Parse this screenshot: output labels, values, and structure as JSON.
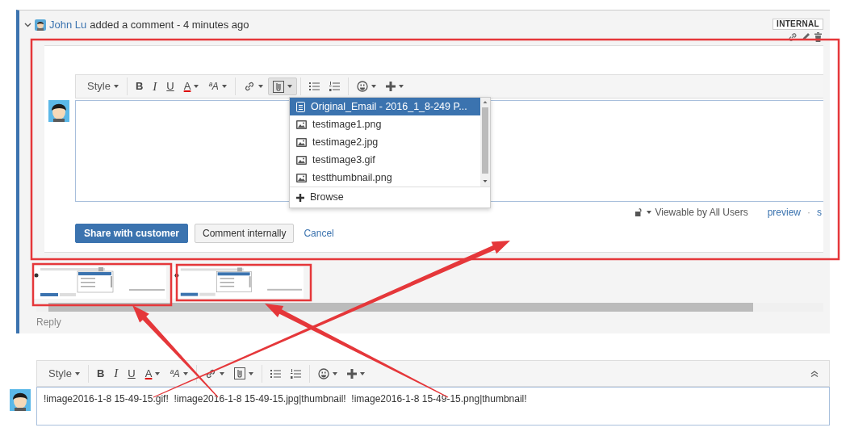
{
  "comment": {
    "author": "John Lu",
    "action": "added a comment - 4 minutes ago",
    "badge": "INTERNAL"
  },
  "editor": {
    "toolbar_groups": [
      [
        {
          "kind": "style",
          "label": "Style",
          "caret": true
        }
      ],
      [
        {
          "kind": "bold",
          "label": "B"
        },
        {
          "kind": "italic",
          "label": "I"
        },
        {
          "kind": "underline",
          "label": "U"
        },
        {
          "kind": "color",
          "label": "A",
          "caret": true
        },
        {
          "kind": "size",
          "label": "ªA",
          "caret": true
        }
      ],
      [
        {
          "kind": "link",
          "caret": true
        },
        {
          "kind": "attach",
          "caret": true,
          "active": true
        }
      ],
      [
        {
          "kind": "bullets"
        },
        {
          "kind": "numbers"
        }
      ],
      [
        {
          "kind": "emoji",
          "caret": true
        },
        {
          "kind": "insert",
          "caret": true
        }
      ]
    ],
    "dropdown": {
      "items": [
        {
          "kind": "document",
          "label": "Original_Email - 2016_1_8-249 P...",
          "selected": true
        },
        {
          "kind": "image",
          "label": "testimage1.png",
          "selected": false
        },
        {
          "kind": "image",
          "label": "testimage2.jpg",
          "selected": false
        },
        {
          "kind": "image",
          "label": "testimage3.gif",
          "selected": false
        },
        {
          "kind": "image",
          "label": "testthumbnail.png",
          "selected": false
        }
      ],
      "browse": "Browse"
    },
    "visibility": "Viewable by All Users",
    "preview": "preview",
    "separator": "·",
    "help_link": "s",
    "buttons": [
      {
        "kind": "primary",
        "label": "Share with customer"
      },
      {
        "kind": "secondary",
        "label": "Comment internally"
      },
      {
        "kind": "link",
        "label": "Cancel"
      }
    ]
  },
  "attachments": [
    {
      "kind": "thumbnail"
    },
    {
      "kind": "thumbnail"
    }
  ],
  "reply": "Reply",
  "bottom_editor": {
    "toolbar_groups": [
      [
        {
          "kind": "style",
          "label": "Style",
          "caret": true
        }
      ],
      [
        {
          "kind": "bold",
          "label": "B"
        },
        {
          "kind": "italic",
          "label": "I"
        },
        {
          "kind": "underline",
          "label": "U"
        },
        {
          "kind": "color",
          "label": "A",
          "caret": true
        },
        {
          "kind": "size",
          "label": "ªA",
          "caret": true
        }
      ],
      [
        {
          "kind": "link",
          "caret": true
        },
        {
          "kind": "attach",
          "caret": true,
          "active": false
        }
      ],
      [
        {
          "kind": "bullets"
        },
        {
          "kind": "numbers"
        }
      ],
      [
        {
          "kind": "emoji",
          "caret": true
        },
        {
          "kind": "insert",
          "caret": true
        }
      ]
    ],
    "collapse": true,
    "text": "!image2016-1-8 15-49-15.gif!  !image2016-1-8 15-49-15.jpg|thumbnail!  !image2016-1-8 15-49-15.png|thumbnail!"
  }
}
